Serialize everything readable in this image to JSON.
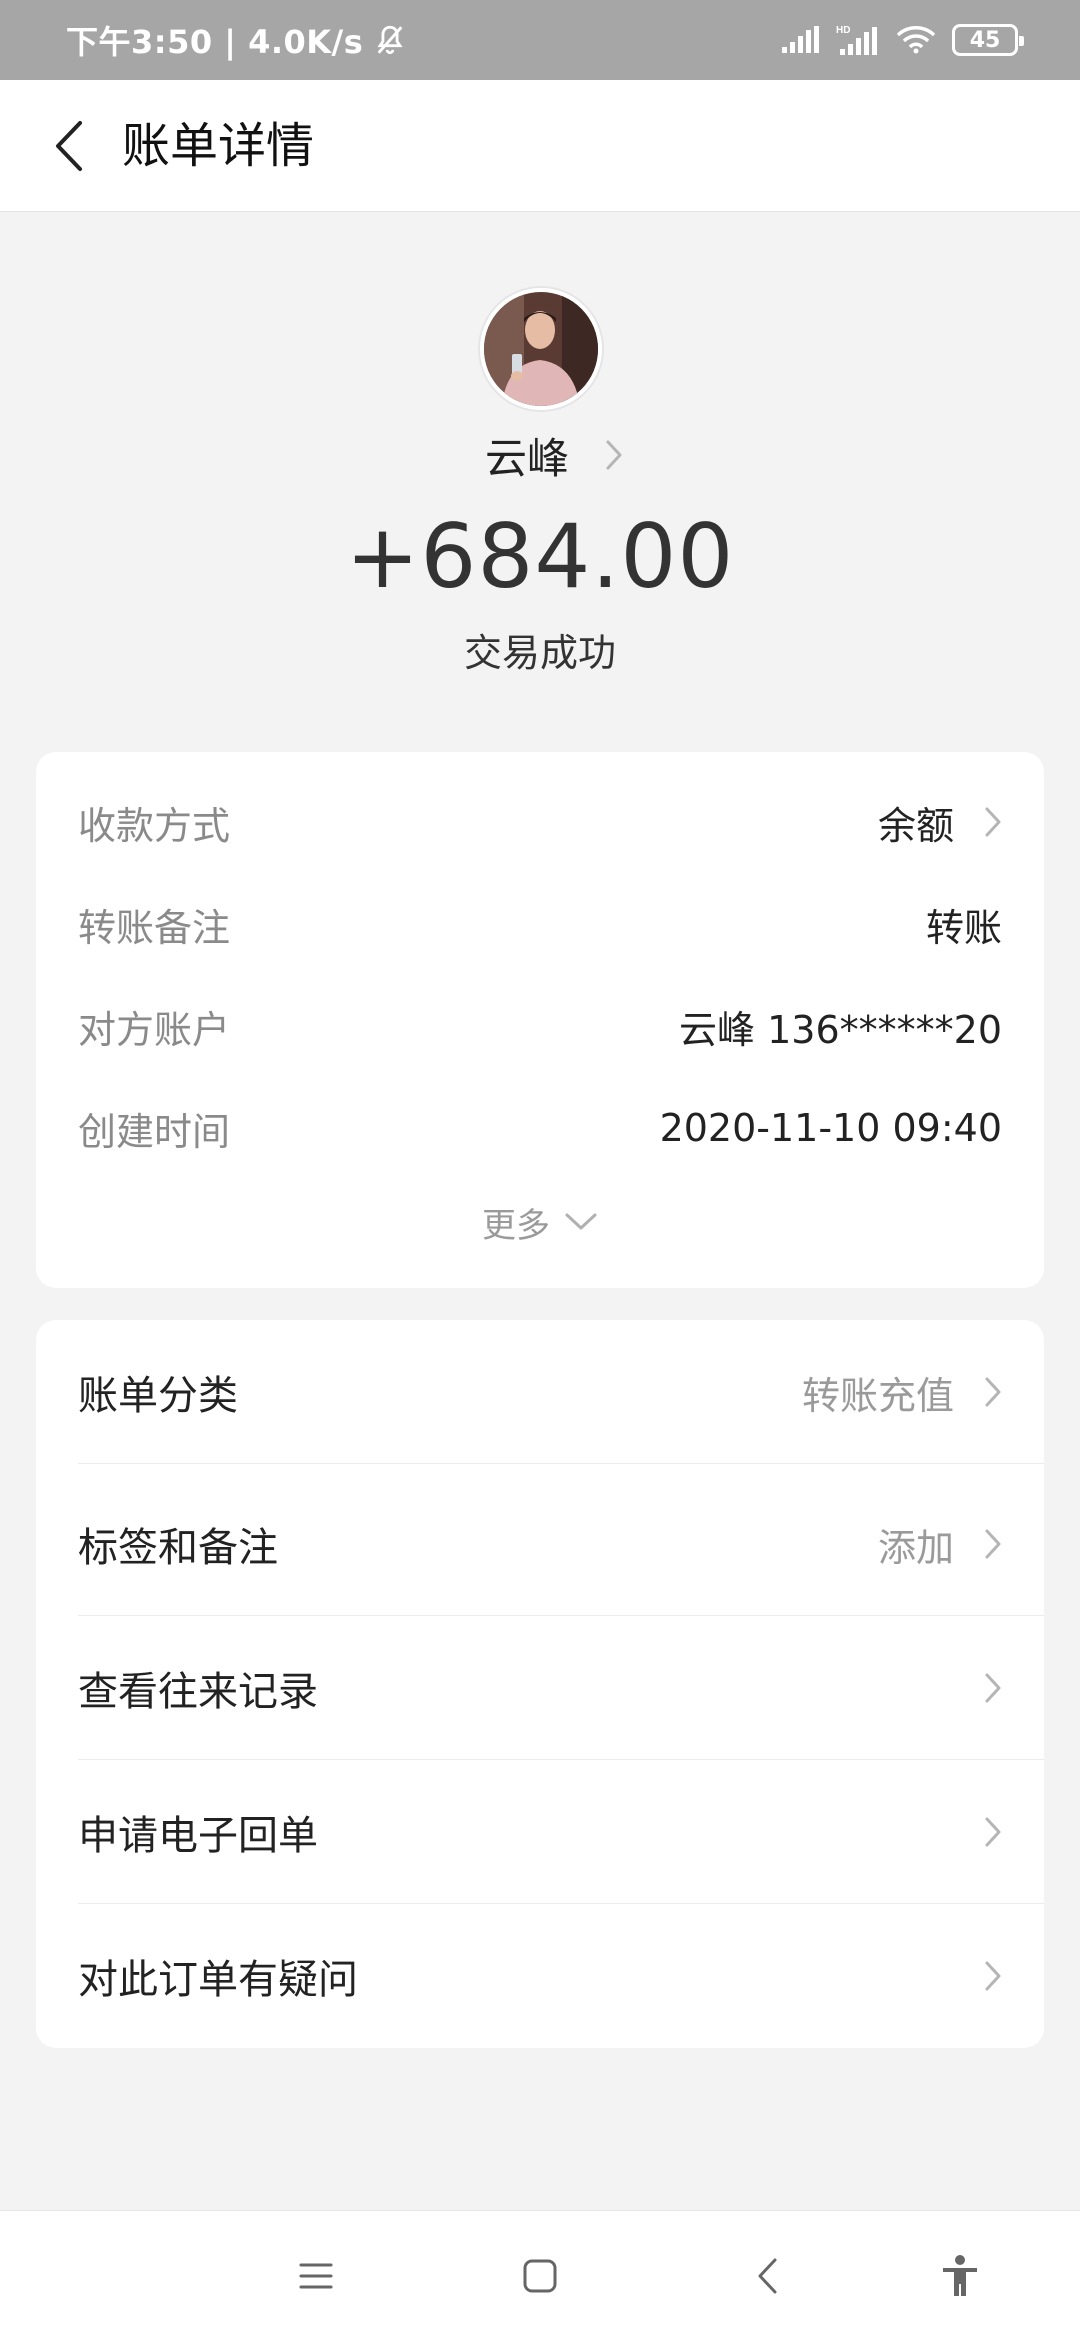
{
  "status_bar": {
    "time_speed": "下午3:50 | 4.0K/s",
    "battery": "45",
    "icons": [
      "mute-bell-icon",
      "signal-icon",
      "hd-signal-icon",
      "wifi-icon",
      "battery-icon"
    ]
  },
  "header": {
    "title": "账单详情",
    "back_icon": "chevron-left-icon"
  },
  "payer": {
    "name": "云峰",
    "amount": "+684.00",
    "status": "交易成功"
  },
  "details": {
    "rows": [
      {
        "label": "收款方式",
        "value": "余额",
        "has_arrow": true
      },
      {
        "label": "转账备注",
        "value": "转账",
        "has_arrow": false
      },
      {
        "label": "对方账户",
        "value": "云峰 136******20",
        "has_arrow": false
      },
      {
        "label": "创建时间",
        "value": "2020-11-10 09:40",
        "has_arrow": false
      }
    ],
    "more_label": "更多"
  },
  "menu": {
    "items": [
      {
        "label": "账单分类",
        "value": "转账充值"
      },
      {
        "label": "标签和备注",
        "value": "添加"
      },
      {
        "label": "查看往来记录",
        "value": ""
      },
      {
        "label": "申请电子回单",
        "value": ""
      },
      {
        "label": "对此订单有疑问",
        "value": ""
      }
    ]
  },
  "system_nav": [
    "menu-icon",
    "home-icon",
    "back-icon",
    "accessibility-icon"
  ],
  "colors": {
    "background": "#f3f3f3",
    "status_bar": "#a6a6a6",
    "label_gray": "#8a8a8a",
    "text_dark": "#222222"
  }
}
